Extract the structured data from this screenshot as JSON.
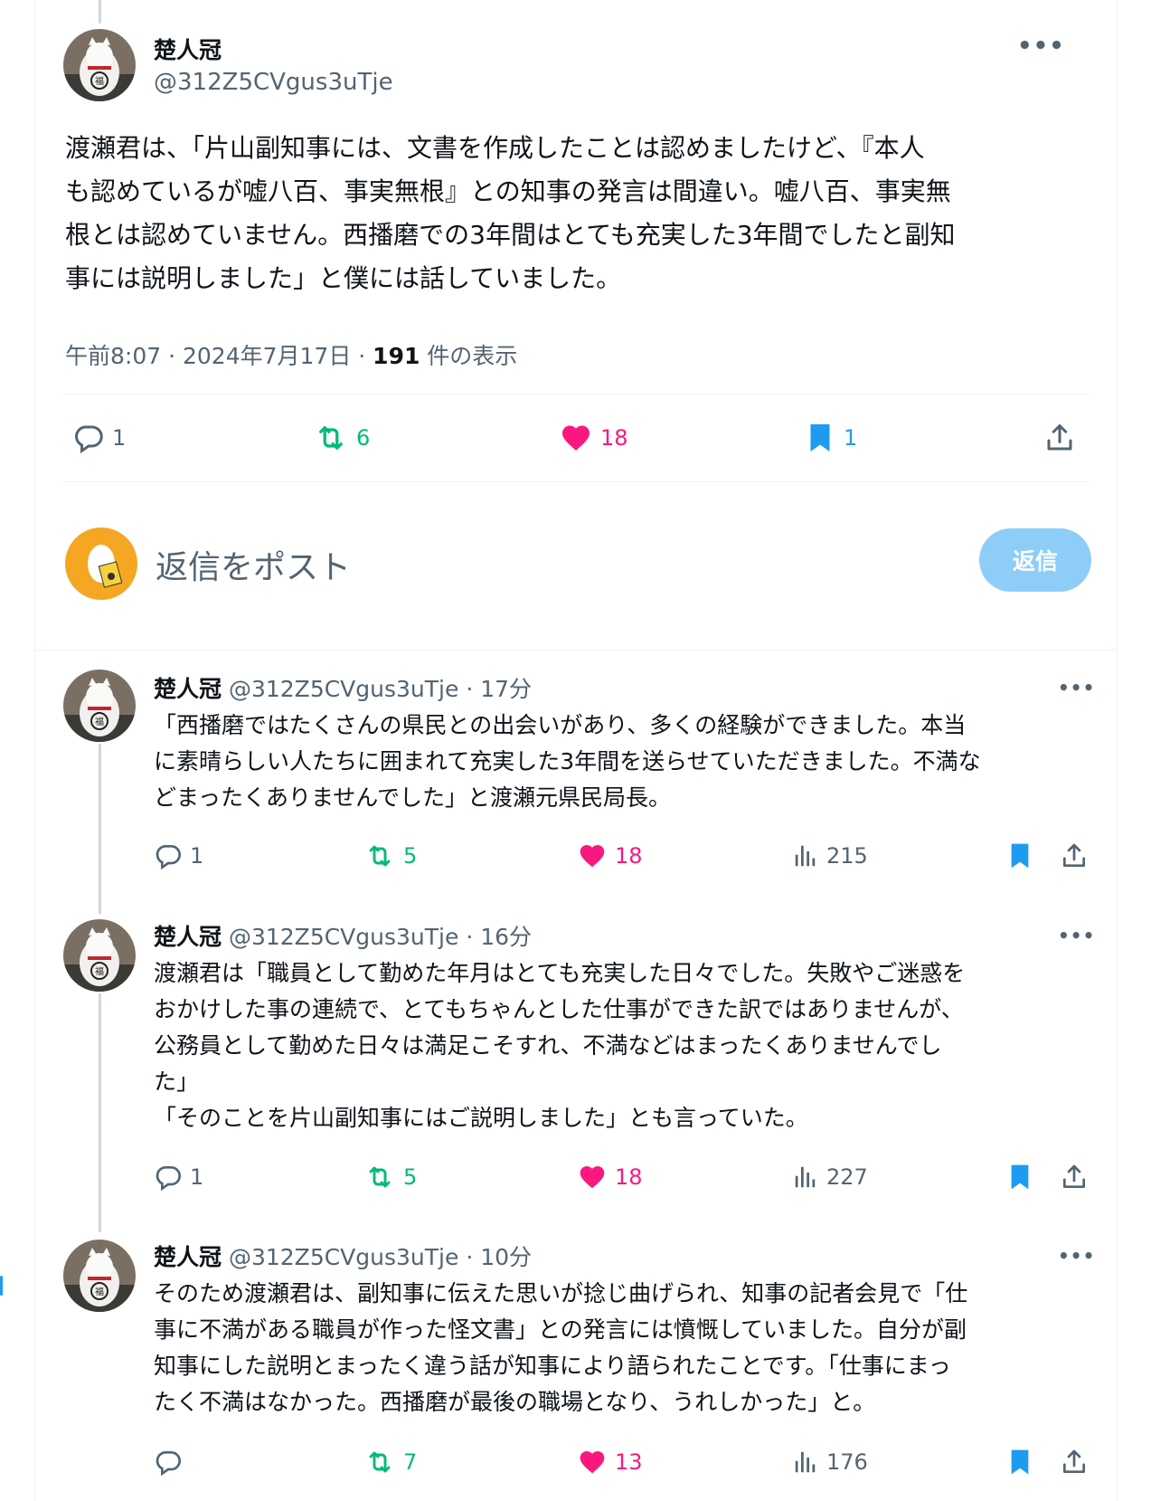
{
  "main": {
    "name": "楚人冠",
    "handle": "@312Z5CVgus3uTje",
    "text": "渡瀬君は、「片山副知事には、文書を作成したことは認めましたけど、『本人\nも認めているが嘘八百、事実無根』との知事の発言は間違い。嘘八百、事実無\n根とは認めていません。西播磨での3年間はとても充実した3年間でしたと副知\n事には説明しました」と僕には話していました。",
    "time": "午前8:07 · 2024年7月17日 · ",
    "views_count": "191",
    "views_label": " 件の表示",
    "counts": {
      "replies": "1",
      "reposts": "6",
      "likes": "18",
      "bookmarks": "1"
    }
  },
  "reply_box": {
    "placeholder": "返信をポスト",
    "button": "返信"
  },
  "replies": [
    {
      "name": "楚人冠",
      "handle": "@312Z5CVgus3uTje",
      "dot": " · ",
      "time": "17分",
      "text": "「西播磨ではたくさんの県民との出会いがあり、多くの経験ができました。本当\nに素晴らしい人たちに囲まれて充実した3年間を送らせていただきました。不満な\nどまったくありませんでした」と渡瀬元県民局長。",
      "replies": "1",
      "reposts": "5",
      "likes": "18",
      "views": "215"
    },
    {
      "name": "楚人冠",
      "handle": "@312Z5CVgus3uTje",
      "dot": " · ",
      "time": "16分",
      "text": "渡瀬君は「職員として勤めた年月はとても充実した日々でした。失敗やご迷惑を\nおかけした事の連続で、とてもちゃんとした仕事ができた訳ではありませんが、\n公務員として勤めた日々は満足こそすれ、不満などはまったくありませんでし\nた」\n「そのことを片山副知事にはご説明しました」とも言っていた。",
      "replies": "1",
      "reposts": "5",
      "likes": "18",
      "views": "227"
    },
    {
      "name": "楚人冠",
      "handle": "@312Z5CVgus3uTje",
      "dot": " · ",
      "time": "10分",
      "text": "そのため渡瀬君は、副知事に伝えた思いが捻じ曲げられ、知事の記者会見で「仕\n事に不満がある職員が作った怪文書」との発言には憤慨していました。自分が副\n知事にした説明とまったく違う話が知事により語られたことです。「仕事にまっ\nたく不満はなかった。西播磨が最後の職場となり、うれしかった」と。",
      "replies": "",
      "reposts": "7",
      "likes": "13",
      "views": "176"
    }
  ],
  "colors": {
    "accent": "#1d9bf0",
    "repost": "#00ba7c",
    "like": "#f91880",
    "muted": "#536471"
  },
  "icons": [
    "reply-icon",
    "repost-icon",
    "like-icon",
    "bookmark-icon",
    "share-icon",
    "views-icon",
    "more-icon"
  ]
}
